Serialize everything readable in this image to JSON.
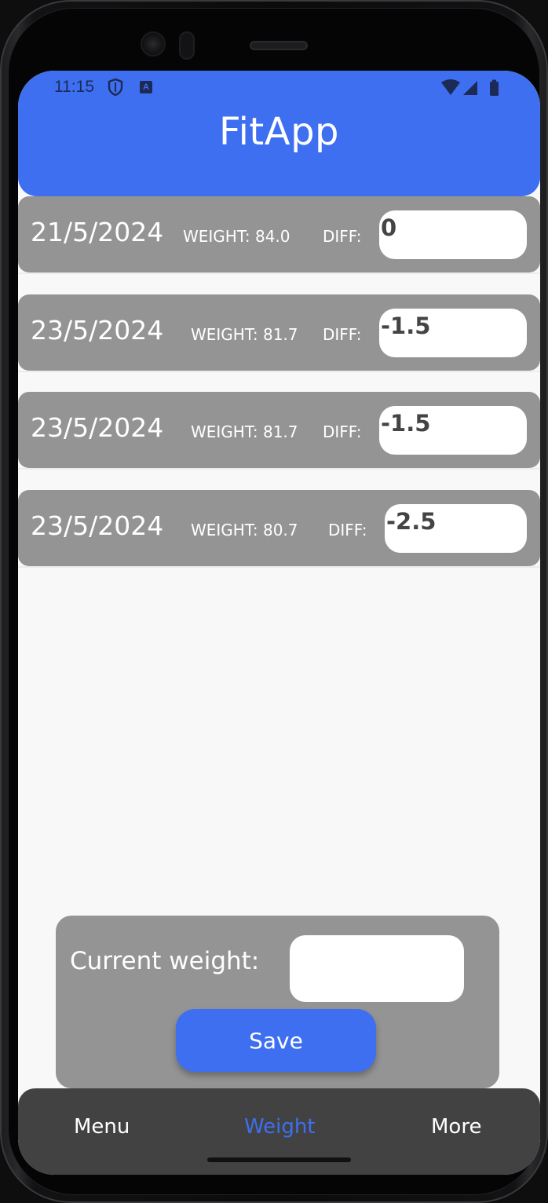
{
  "status_bar": {
    "time": "11:15"
  },
  "app": {
    "title": "FitApp"
  },
  "entries": [
    {
      "date": "21/5/2024",
      "weight_label": "WEIGHT: 84.0",
      "diff_label": "DIFF:",
      "diff": "0"
    },
    {
      "date": "23/5/2024",
      "weight_label": "WEIGHT: 81.7",
      "diff_label": "DIFF:",
      "diff": "-1.5"
    },
    {
      "date": "23/5/2024",
      "weight_label": "WEIGHT: 81.7",
      "diff_label": "DIFF:",
      "diff": "-1.5"
    },
    {
      "date": "23/5/2024",
      "weight_label": "WEIGHT: 80.7",
      "diff_label": "DIFF:",
      "diff": "-2.5"
    }
  ],
  "weight_form": {
    "label": "Current weight:",
    "value": "",
    "save_label": "Save"
  },
  "nav": {
    "items": [
      {
        "label": "Menu",
        "active": false
      },
      {
        "label": "Weight",
        "active": true
      },
      {
        "label": "More",
        "active": false
      }
    ]
  },
  "colors": {
    "accent": "#3e6ff0",
    "card": "#959494",
    "nav_bg": "#424242"
  }
}
